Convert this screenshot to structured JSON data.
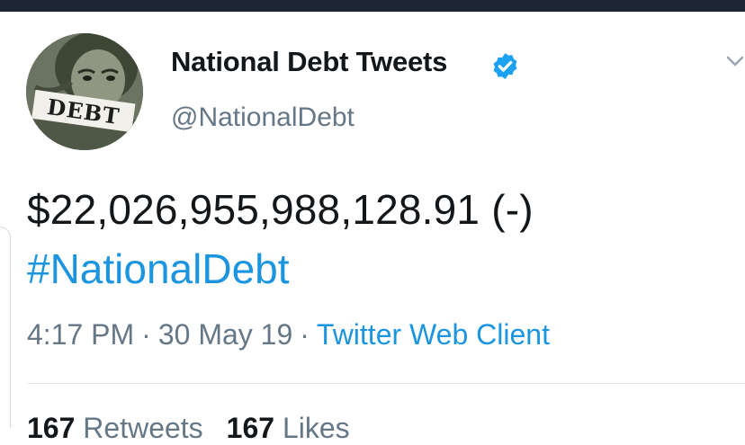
{
  "tweet": {
    "display_name": "National Debt Tweets",
    "handle": "@NationalDebt",
    "avatar_text": "DEBT",
    "amount_text": "$22,026,955,988,128.91 (-)",
    "hashtag": "#NationalDebt",
    "time": "4:17 PM",
    "date": "30 May 19",
    "separator": "·",
    "client": "Twitter Web Client",
    "retweets_count": "167",
    "retweets_label": "Retweets",
    "likes_count": "167",
    "likes_label": "Likes"
  },
  "icons": {
    "verified": "verified-badge-icon",
    "caret": "chevron-down-icon"
  },
  "colors": {
    "link": "#1b95e0",
    "secondary_text": "#657786",
    "primary_text": "#14171a",
    "top_bar": "#1c2733",
    "verified": "#1da1f2"
  }
}
